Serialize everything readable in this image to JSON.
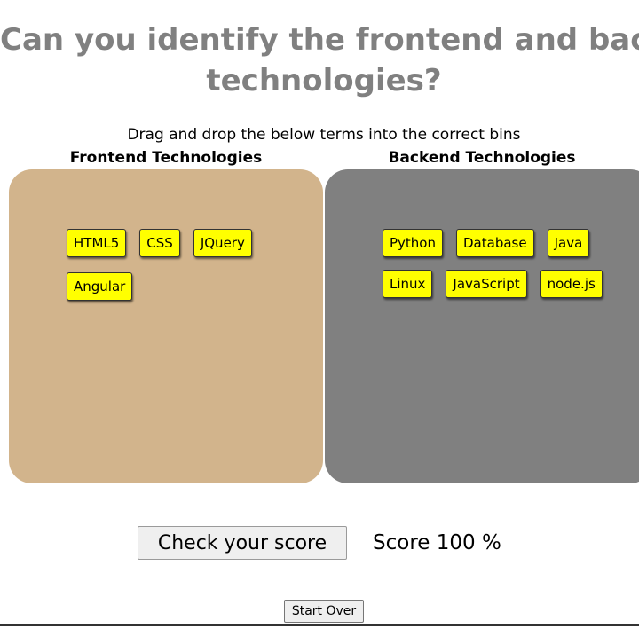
{
  "quiz": {
    "title_line1": "Can you identify the frontend and backend",
    "title_line2": "technologies?",
    "instructions": "Drag and drop the below terms into the correct bins"
  },
  "bins": {
    "frontend": {
      "heading": "Frontend Technologies",
      "color": "#d2b48c",
      "terms": [
        "HTML5",
        "CSS",
        "JQuery",
        "Angular"
      ]
    },
    "backend": {
      "heading": "Backend Technologies",
      "color": "#808080",
      "terms": [
        "Python",
        "Database",
        "Java",
        "Linux",
        "JavaScript",
        "node.js"
      ]
    }
  },
  "term_color": "#ffff00",
  "actions": {
    "check_label": "Check your score",
    "score_text": "Score 100 %",
    "start_over_label": "Start Over"
  }
}
